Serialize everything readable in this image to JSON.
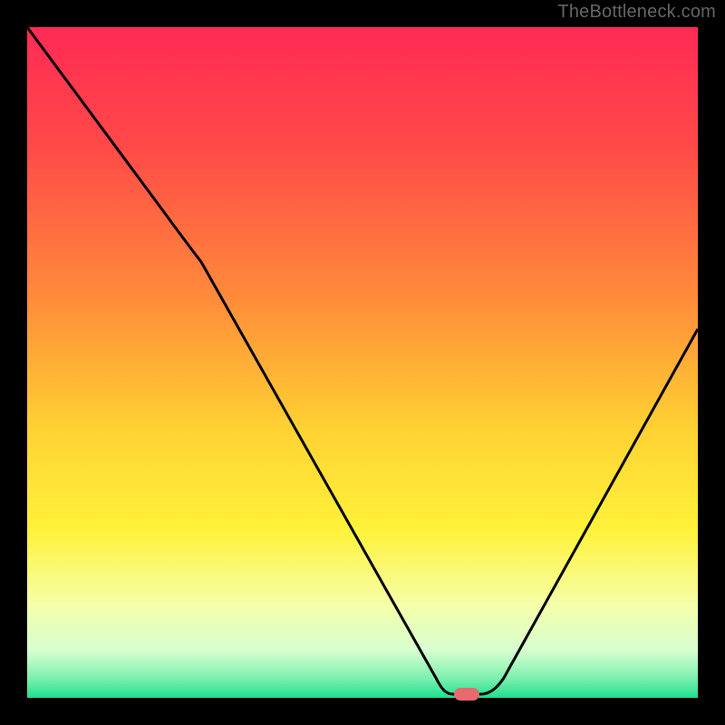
{
  "watermark": {
    "text": "TheBottleneck.com"
  },
  "chart_data": {
    "type": "line",
    "title": "",
    "xlabel": "",
    "ylabel": "",
    "xlim": [
      0,
      100
    ],
    "ylim": [
      0,
      100
    ],
    "background_gradient_stops": [
      {
        "offset": 0.0,
        "color": "#ff2a55"
      },
      {
        "offset": 0.18,
        "color": "#ff4a48"
      },
      {
        "offset": 0.4,
        "color": "#ff8a3a"
      },
      {
        "offset": 0.6,
        "color": "#ffd233"
      },
      {
        "offset": 0.75,
        "color": "#fff23a"
      },
      {
        "offset": 0.86,
        "color": "#f6ffa8"
      },
      {
        "offset": 0.93,
        "color": "#d6ffd0"
      },
      {
        "offset": 0.97,
        "color": "#7ff0b0"
      },
      {
        "offset": 1.0,
        "color": "#1fe08f"
      }
    ],
    "curve_points_xy": [
      [
        0,
        100
      ],
      [
        20,
        73
      ],
      [
        26,
        65
      ],
      [
        61,
        3
      ],
      [
        63,
        0.5
      ],
      [
        68,
        0.5
      ],
      [
        71,
        3
      ],
      [
        100,
        55
      ]
    ],
    "optimal_marker_xy": [
      65.5,
      0.5
    ],
    "grid": false,
    "legend": false
  }
}
